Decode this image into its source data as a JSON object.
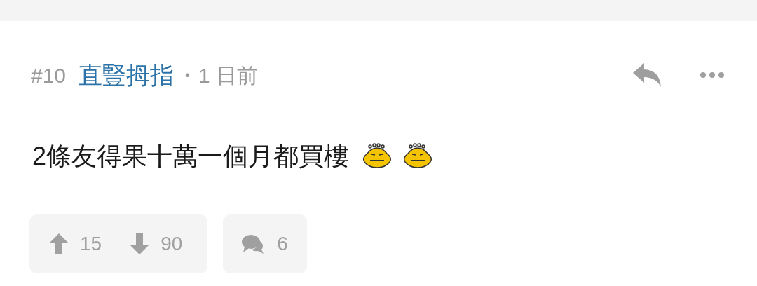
{
  "post": {
    "number": "#10",
    "author": "直豎拇指",
    "separator": "•",
    "time": "1 日前",
    "body": "2條友得果十萬一個月都買樓",
    "emoticons": [
      {
        "kind": "sticker"
      },
      {
        "kind": "sticker"
      }
    ],
    "votes": {
      "up": "15",
      "down": "90"
    },
    "replies": "6"
  }
}
